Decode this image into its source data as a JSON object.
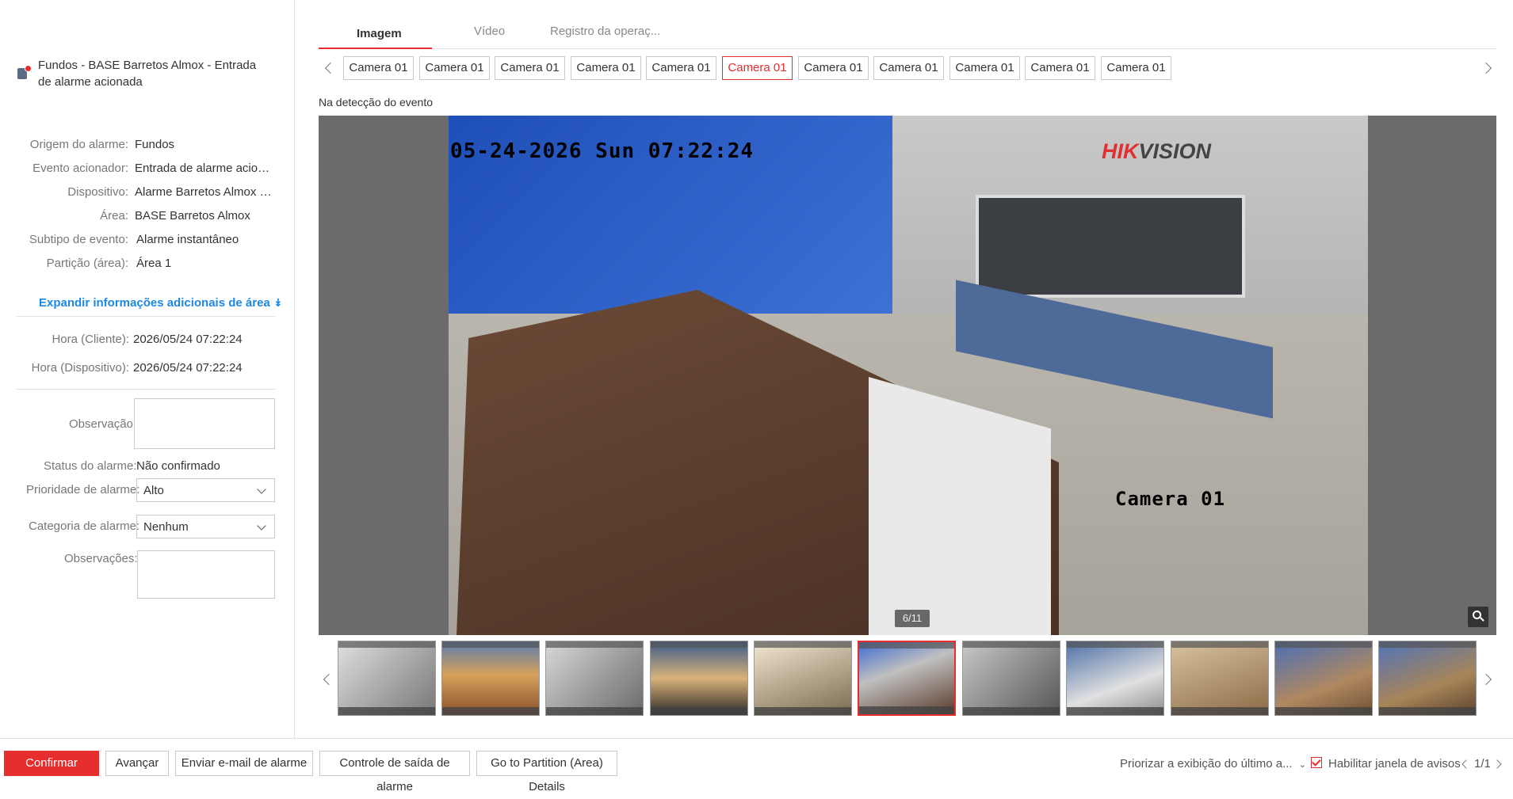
{
  "alarm": {
    "title": "Fundos - BASE Barretos Almox - Entrada de alarme acionada"
  },
  "details": [
    {
      "key": "Origem do alarme:",
      "value": "Fundos"
    },
    {
      "key": "Evento acionador:",
      "value": "Entrada de alarme acionada"
    },
    {
      "key": "Dispositivo:",
      "value": "Alarme Barretos Almox FR..."
    },
    {
      "key": "Área:",
      "value": "BASE Barretos Almox"
    },
    {
      "key": "Subtipo de evento:",
      "value": "Alarme instantâneo"
    },
    {
      "key": "Partição (área):",
      "value": "Área 1"
    }
  ],
  "expand_label": "Expandir informações adicionais de área",
  "times": [
    {
      "key": "Hora (Cliente):",
      "value": "2026/05/24 07:22:24"
    },
    {
      "key": "Hora (Dispositivo):",
      "value": "2026/05/24 07:22:24"
    }
  ],
  "form": {
    "observacao_label": "Observação:",
    "status_label": "Status do alarme:",
    "status_value": "Não confirmado",
    "prioridade_label": "Prioridade de alarme:",
    "prioridade_value": "Alto",
    "categoria_label": "Categoria de alarme:",
    "categoria_value": "Nenhum",
    "observacoes_label": "Observações:"
  },
  "tabs": [
    "Imagem",
    "Vídeo",
    "Registro da operaç..."
  ],
  "cameras": [
    "Camera 01",
    "Camera 01",
    "Camera 01",
    "Camera 01",
    "Camera 01",
    "Camera 01",
    "Camera 01",
    "Camera 01",
    "Camera 01",
    "Camera 01",
    "Camera 01"
  ],
  "selected_camera": 5,
  "event_label": "Na detecção do evento",
  "viewer": {
    "timestamp": "05-24-2026 Sun 07:22:24",
    "brand_red": "HIK",
    "brand_dark": "VISION",
    "camera_osd": "Camera 01",
    "counter": "6/11"
  },
  "footer": {
    "confirm": "Confirmar",
    "next": "Avançar",
    "email": "Enviar e-mail de alarme",
    "output": "Controle de saída de alarme",
    "partition": "Go to Partition (Area) Details",
    "priority_display": "Priorizar a exibição do último a...",
    "enable_popup": "Habilitar janela de avisos",
    "pager": "1/1"
  },
  "colors": {
    "accent": "#e62e2e",
    "link": "#1e88e5"
  }
}
